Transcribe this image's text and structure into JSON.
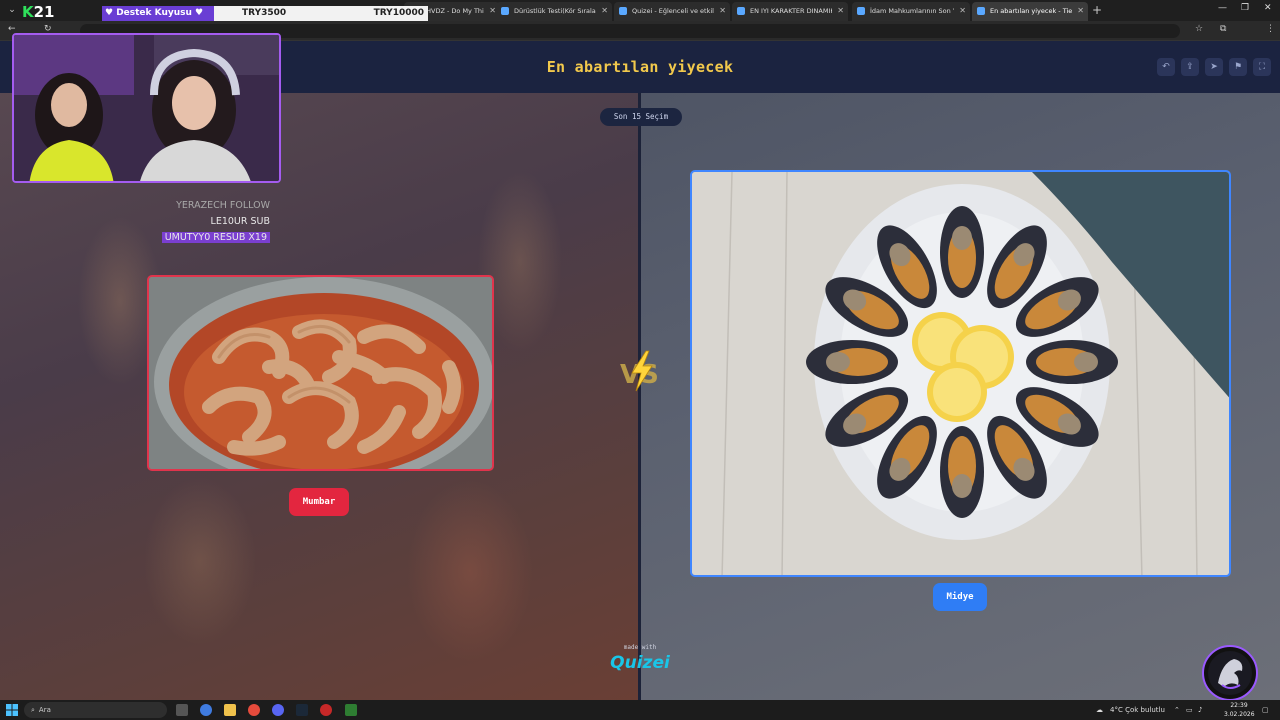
{
  "browser": {
    "tabs": [
      {
        "label": "SHVDZ - Do My Thing (T",
        "active": false
      },
      {
        "label": "Dürüstlük Testi(Kör Sıralama) -",
        "active": false
      },
      {
        "label": "Quizei - Eğlenceli ve etkileşimli",
        "active": false
      },
      {
        "label": "EN IYI KARAKTER DINAMIKLERI",
        "active": false
      },
      {
        "label": "İdam Mahkumlarının Son Yeme",
        "active": false
      },
      {
        "label": "En abartılan yiyecek - Tier List,",
        "active": true
      }
    ]
  },
  "overlay": {
    "follower_count": "21",
    "donation_label": "♥ Destek Kuyusu ♥",
    "goal_current": "TRY3500",
    "goal_target": "TRY10000",
    "events": [
      {
        "text": "YERAZECH  FOLLOW",
        "style": "faded"
      },
      {
        "text": "LE10UR  SUB",
        "style": "normal"
      },
      {
        "text": "UMUTYY0  RESUB X19",
        "style": "highlight"
      }
    ]
  },
  "page": {
    "title": "En abartılan yiyecek",
    "round_badge": "Son 15 Seçim",
    "left_option": {
      "name": "Mumbar",
      "accent": "#e3263f"
    },
    "right_option": {
      "name": "Midye",
      "accent": "#2f7df5"
    },
    "vs_text": "VS",
    "made_with": "made with",
    "brand": "Quizei",
    "header_actions": [
      "undo-icon",
      "share-icon",
      "send-icon",
      "flag-icon",
      "fullscreen-icon"
    ]
  },
  "taskbar": {
    "search_placeholder": "Ara",
    "weather": "4°C  Çok bulutlu",
    "time": "22:39",
    "date": "3.02.2026"
  }
}
